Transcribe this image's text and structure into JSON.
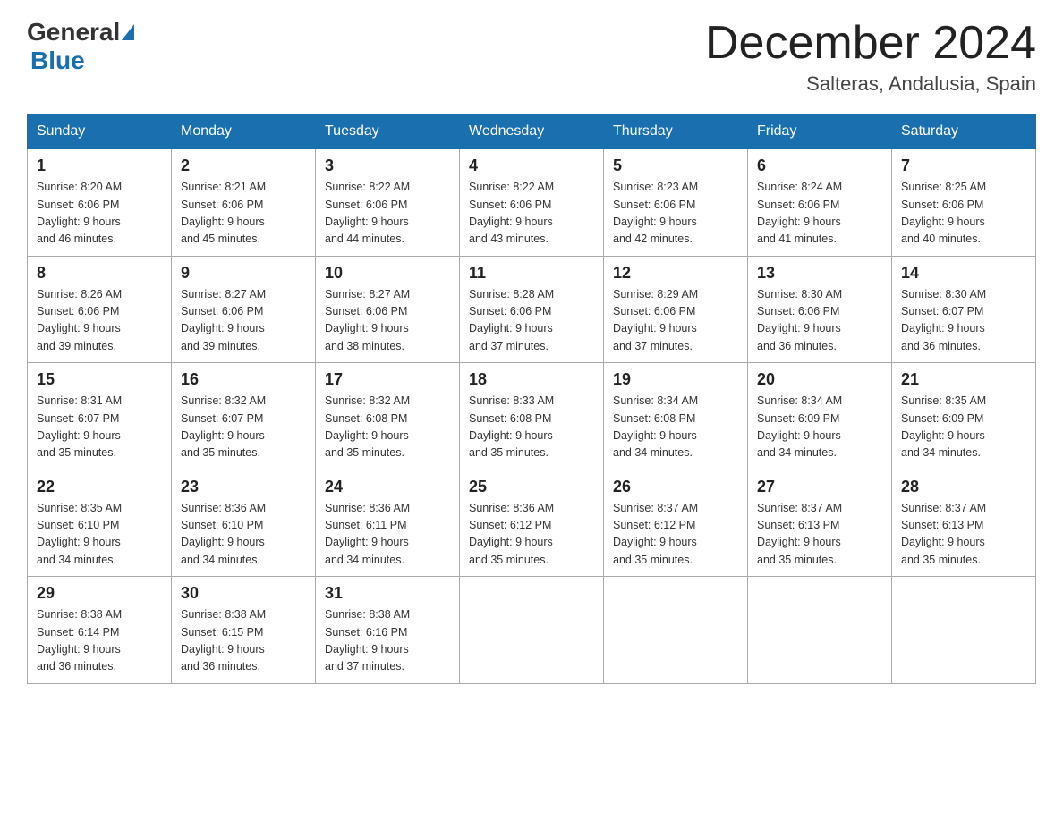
{
  "header": {
    "logo_general": "General",
    "logo_blue": "Blue",
    "month_title": "December 2024",
    "location": "Salteras, Andalusia, Spain"
  },
  "days_of_week": [
    "Sunday",
    "Monday",
    "Tuesday",
    "Wednesday",
    "Thursday",
    "Friday",
    "Saturday"
  ],
  "weeks": [
    [
      {
        "day": "1",
        "sunrise": "8:20 AM",
        "sunset": "6:06 PM",
        "daylight": "9 hours and 46 minutes."
      },
      {
        "day": "2",
        "sunrise": "8:21 AM",
        "sunset": "6:06 PM",
        "daylight": "9 hours and 45 minutes."
      },
      {
        "day": "3",
        "sunrise": "8:22 AM",
        "sunset": "6:06 PM",
        "daylight": "9 hours and 44 minutes."
      },
      {
        "day": "4",
        "sunrise": "8:22 AM",
        "sunset": "6:06 PM",
        "daylight": "9 hours and 43 minutes."
      },
      {
        "day": "5",
        "sunrise": "8:23 AM",
        "sunset": "6:06 PM",
        "daylight": "9 hours and 42 minutes."
      },
      {
        "day": "6",
        "sunrise": "8:24 AM",
        "sunset": "6:06 PM",
        "daylight": "9 hours and 41 minutes."
      },
      {
        "day": "7",
        "sunrise": "8:25 AM",
        "sunset": "6:06 PM",
        "daylight": "9 hours and 40 minutes."
      }
    ],
    [
      {
        "day": "8",
        "sunrise": "8:26 AM",
        "sunset": "6:06 PM",
        "daylight": "9 hours and 39 minutes."
      },
      {
        "day": "9",
        "sunrise": "8:27 AM",
        "sunset": "6:06 PM",
        "daylight": "9 hours and 39 minutes."
      },
      {
        "day": "10",
        "sunrise": "8:27 AM",
        "sunset": "6:06 PM",
        "daylight": "9 hours and 38 minutes."
      },
      {
        "day": "11",
        "sunrise": "8:28 AM",
        "sunset": "6:06 PM",
        "daylight": "9 hours and 37 minutes."
      },
      {
        "day": "12",
        "sunrise": "8:29 AM",
        "sunset": "6:06 PM",
        "daylight": "9 hours and 37 minutes."
      },
      {
        "day": "13",
        "sunrise": "8:30 AM",
        "sunset": "6:06 PM",
        "daylight": "9 hours and 36 minutes."
      },
      {
        "day": "14",
        "sunrise": "8:30 AM",
        "sunset": "6:07 PM",
        "daylight": "9 hours and 36 minutes."
      }
    ],
    [
      {
        "day": "15",
        "sunrise": "8:31 AM",
        "sunset": "6:07 PM",
        "daylight": "9 hours and 35 minutes."
      },
      {
        "day": "16",
        "sunrise": "8:32 AM",
        "sunset": "6:07 PM",
        "daylight": "9 hours and 35 minutes."
      },
      {
        "day": "17",
        "sunrise": "8:32 AM",
        "sunset": "6:08 PM",
        "daylight": "9 hours and 35 minutes."
      },
      {
        "day": "18",
        "sunrise": "8:33 AM",
        "sunset": "6:08 PM",
        "daylight": "9 hours and 35 minutes."
      },
      {
        "day": "19",
        "sunrise": "8:34 AM",
        "sunset": "6:08 PM",
        "daylight": "9 hours and 34 minutes."
      },
      {
        "day": "20",
        "sunrise": "8:34 AM",
        "sunset": "6:09 PM",
        "daylight": "9 hours and 34 minutes."
      },
      {
        "day": "21",
        "sunrise": "8:35 AM",
        "sunset": "6:09 PM",
        "daylight": "9 hours and 34 minutes."
      }
    ],
    [
      {
        "day": "22",
        "sunrise": "8:35 AM",
        "sunset": "6:10 PM",
        "daylight": "9 hours and 34 minutes."
      },
      {
        "day": "23",
        "sunrise": "8:36 AM",
        "sunset": "6:10 PM",
        "daylight": "9 hours and 34 minutes."
      },
      {
        "day": "24",
        "sunrise": "8:36 AM",
        "sunset": "6:11 PM",
        "daylight": "9 hours and 34 minutes."
      },
      {
        "day": "25",
        "sunrise": "8:36 AM",
        "sunset": "6:12 PM",
        "daylight": "9 hours and 35 minutes."
      },
      {
        "day": "26",
        "sunrise": "8:37 AM",
        "sunset": "6:12 PM",
        "daylight": "9 hours and 35 minutes."
      },
      {
        "day": "27",
        "sunrise": "8:37 AM",
        "sunset": "6:13 PM",
        "daylight": "9 hours and 35 minutes."
      },
      {
        "day": "28",
        "sunrise": "8:37 AM",
        "sunset": "6:13 PM",
        "daylight": "9 hours and 35 minutes."
      }
    ],
    [
      {
        "day": "29",
        "sunrise": "8:38 AM",
        "sunset": "6:14 PM",
        "daylight": "9 hours and 36 minutes."
      },
      {
        "day": "30",
        "sunrise": "8:38 AM",
        "sunset": "6:15 PM",
        "daylight": "9 hours and 36 minutes."
      },
      {
        "day": "31",
        "sunrise": "8:38 AM",
        "sunset": "6:16 PM",
        "daylight": "9 hours and 37 minutes."
      },
      null,
      null,
      null,
      null
    ]
  ],
  "labels": {
    "sunrise": "Sunrise:",
    "sunset": "Sunset:",
    "daylight": "Daylight:"
  }
}
